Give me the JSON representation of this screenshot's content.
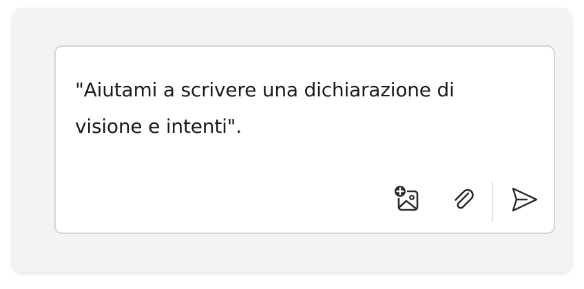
{
  "composer": {
    "prompt_text": "\"Aiutami a scrivere una dichiarazione di visione e intenti\"."
  },
  "toolbar": {
    "add_image_icon": "image-add-icon",
    "attach_icon": "paperclip-icon",
    "send_icon": "send-icon"
  },
  "colors": {
    "panel_background": "#f3f3f3",
    "composer_border": "#d4d4d4",
    "text": "#1b1b1b",
    "icon": "#2b2b2b"
  }
}
